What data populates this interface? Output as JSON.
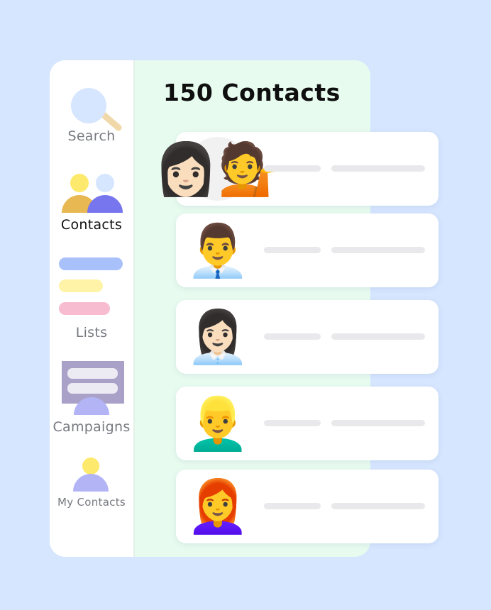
{
  "sidebar": {
    "items": [
      {
        "label": "Search",
        "icon": "search-icon"
      },
      {
        "label": "Contacts",
        "icon": "people-icon"
      },
      {
        "label": "Lists",
        "icon": "lists-icon"
      },
      {
        "label": "Campaigns",
        "icon": "campaigns-icon"
      },
      {
        "label": "My Contacts",
        "icon": "my-contacts-icon"
      }
    ],
    "active": "Contacts"
  },
  "main": {
    "title": "150 Contacts",
    "contacts": [
      {
        "avatar": "👩🏻‍💁",
        "avatar_name": "woman-tipping-hand-avatar"
      },
      {
        "avatar": "👨‍💼",
        "avatar_name": "man-office-worker-avatar"
      },
      {
        "avatar": "👩🏻‍💼",
        "avatar_name": "woman-office-worker-avatar"
      },
      {
        "avatar": "👱‍♂️",
        "avatar_name": "blond-man-avatar"
      },
      {
        "avatar": "👩‍🦰",
        "avatar_name": "red-haired-woman-avatar"
      }
    ]
  },
  "colors": {
    "background": "#d6e6ff",
    "panel": "#e8fbef",
    "sidebar": "#ffffff",
    "accent_blue": "#a9c1fb",
    "accent_yellow": "#fff3a8",
    "accent_pink": "#f7bcd0",
    "accent_purple": "#b3b4f6",
    "accent_gold": "#e9b84f"
  }
}
